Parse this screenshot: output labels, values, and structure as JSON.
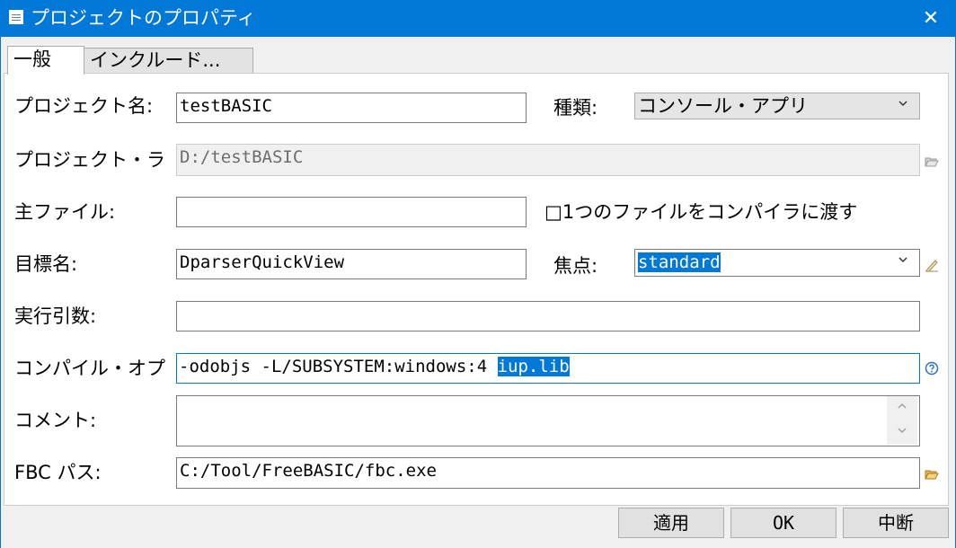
{
  "window": {
    "title": "プロジェクトのプロパティ",
    "close": "✕"
  },
  "tabs": [
    {
      "label": "一般"
    },
    {
      "label": "インクルード..."
    }
  ],
  "form": {
    "project_name": {
      "label": "プロジェクト名:",
      "value": "testBASIC"
    },
    "type": {
      "label": "種類:",
      "value": "コンソール・アプリ"
    },
    "project_folder": {
      "label": "プロジェクト・ラ",
      "value": "D:/testBASIC"
    },
    "main_file": {
      "label": "主ファイル:",
      "value": ""
    },
    "single_file": {
      "label": "□1つのファイルをコンパイラに渡す"
    },
    "target_name": {
      "label": "目標名:",
      "value": "DparserQuickView"
    },
    "focus": {
      "label": "焦点:",
      "value": "standard"
    },
    "exec_args": {
      "label": "実行引数:",
      "value": ""
    },
    "compile_options": {
      "label": "コンパイル・オプ",
      "value_plain": "-odobjs -L/SUBSYSTEM:windows:4 ",
      "value_selected": "iup.lib"
    },
    "comment": {
      "label": "コメント:",
      "value": ""
    },
    "fbc_path": {
      "label": "FBC パス:",
      "value": "C:/Tool/FreeBASIC/fbc.exe"
    }
  },
  "buttons": {
    "apply": "適用",
    "ok": "OK",
    "cancel": "中断"
  },
  "icons": {
    "chevron": "chevron-down-icon",
    "folder": "folder-open-icon",
    "edit": "pencil-icon",
    "help": "help-icon",
    "scroll_up": "scroll-up-icon",
    "scroll_down": "scroll-down-icon"
  },
  "colors": {
    "titlebar": "#0078d7",
    "selection": "#0078d7",
    "window": "#f0f0f0"
  }
}
